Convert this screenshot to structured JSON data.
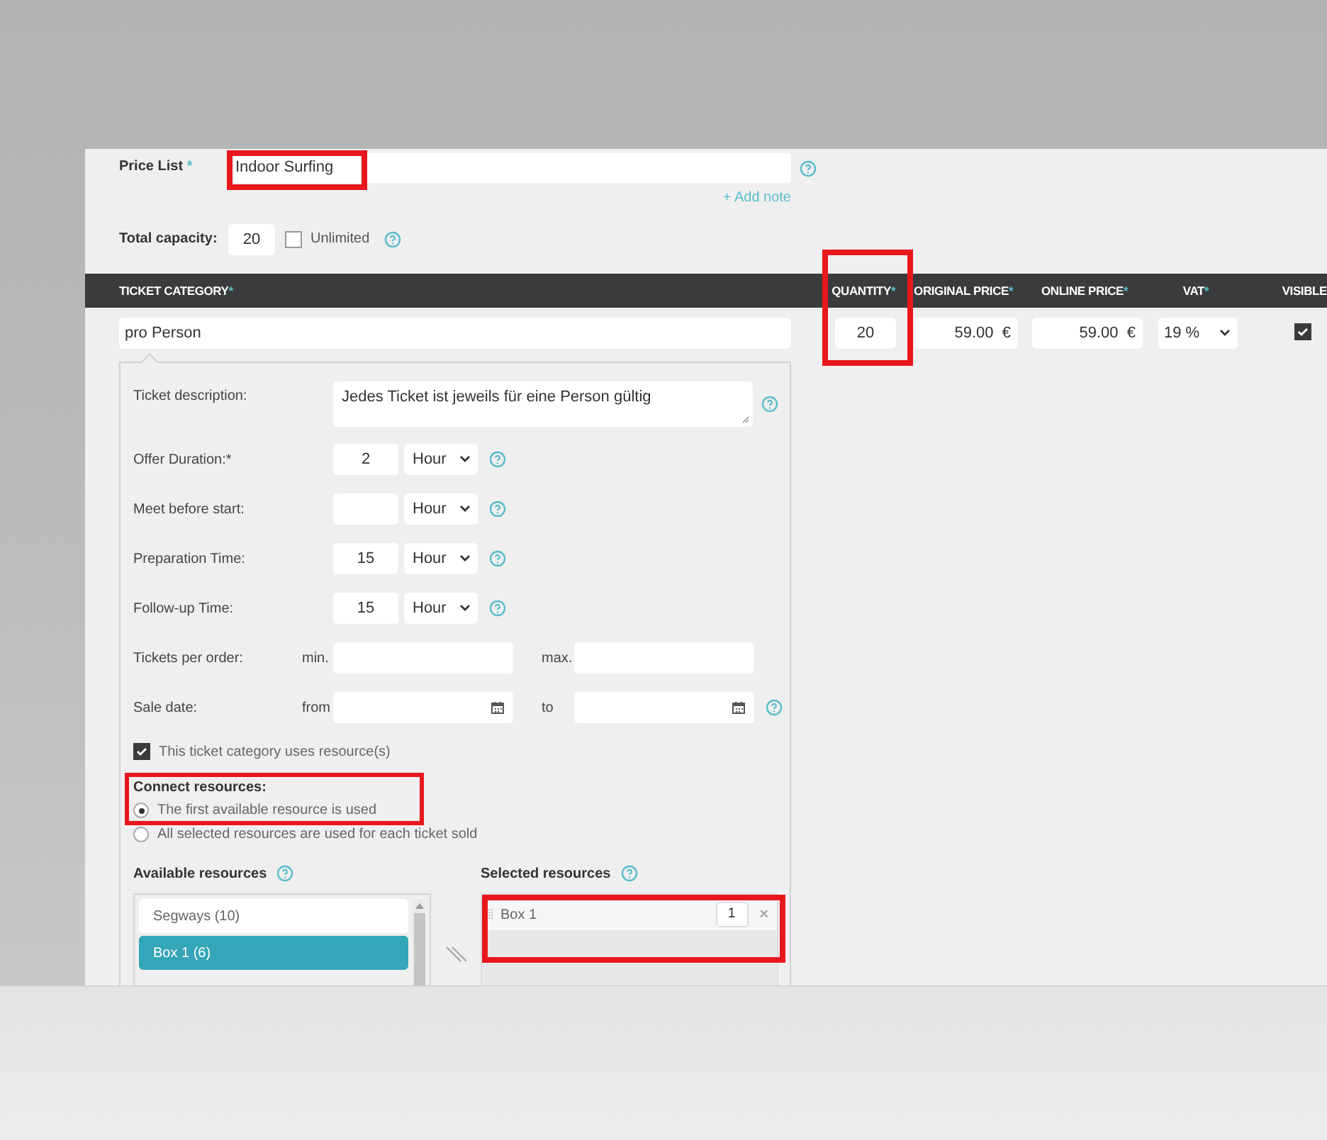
{
  "price_list": {
    "label": "Price List",
    "required_mark": "*",
    "value": "Indoor Surfing",
    "add_note": "+ Add note"
  },
  "capacity": {
    "label": "Total capacity:",
    "value": "20",
    "unlimited_label": "Unlimited",
    "unlimited": false
  },
  "table": {
    "columns": [
      {
        "label": "TICKET CATEGORY",
        "required_mark": "*"
      },
      {
        "label": "QUANTITY",
        "required_mark": "*"
      },
      {
        "label": "ORIGINAL PRICE",
        "required_mark": "*"
      },
      {
        "label": "ONLINE PRICE",
        "required_mark": "*"
      },
      {
        "label": "VAT",
        "required_mark": "*"
      },
      {
        "label": "VISIBLE"
      }
    ],
    "rows": [
      {
        "category": "pro Person",
        "quantity": "20",
        "original_price": "59.00",
        "original_currency": "€",
        "online_price": "59.00",
        "online_currency": "€",
        "vat": "19 %",
        "visible": true
      }
    ]
  },
  "details": {
    "fields": [
      {
        "kind": "textarea",
        "label": "Ticket description:",
        "value": "Jedes Ticket ist jeweils für eine Person gültig",
        "help": true
      },
      {
        "kind": "duration",
        "label": "Offer Duration:",
        "required_mark": "*",
        "value": "2",
        "unit": "Hour",
        "help": true
      },
      {
        "kind": "duration",
        "label": "Meet before start:",
        "unit": "Hour",
        "help": true
      },
      {
        "kind": "duration",
        "label": "Preparation Time:",
        "value": "15",
        "unit": "Hour",
        "help": true
      },
      {
        "kind": "duration",
        "label": "Follow-up Time:",
        "value": "15",
        "unit": "Hour",
        "help": true
      },
      {
        "kind": "range",
        "label": "Tickets per order:",
        "from_label": "min.",
        "to_label": "max.",
        "help": false
      },
      {
        "kind": "date",
        "label": "Sale date:",
        "from_label": "from",
        "to_label": "to",
        "help": true
      }
    ],
    "uses_resources": {
      "label": "This ticket category uses resource(s)",
      "checked": true
    },
    "connect": {
      "title": "Connect resources:",
      "options": [
        {
          "label": "The first available resource is used",
          "selected": true
        },
        {
          "label": "All selected resources are used for each ticket sold",
          "selected": false
        }
      ]
    },
    "available": {
      "label": "Available resources",
      "items": [
        {
          "label": "Segways (10)",
          "selected": false
        },
        {
          "label": "Box 1 (6)",
          "selected": true
        }
      ]
    },
    "selected": {
      "label": "Selected resources",
      "items": [
        {
          "label": "Box 1",
          "count": "1",
          "remove": "×"
        }
      ]
    }
  }
}
